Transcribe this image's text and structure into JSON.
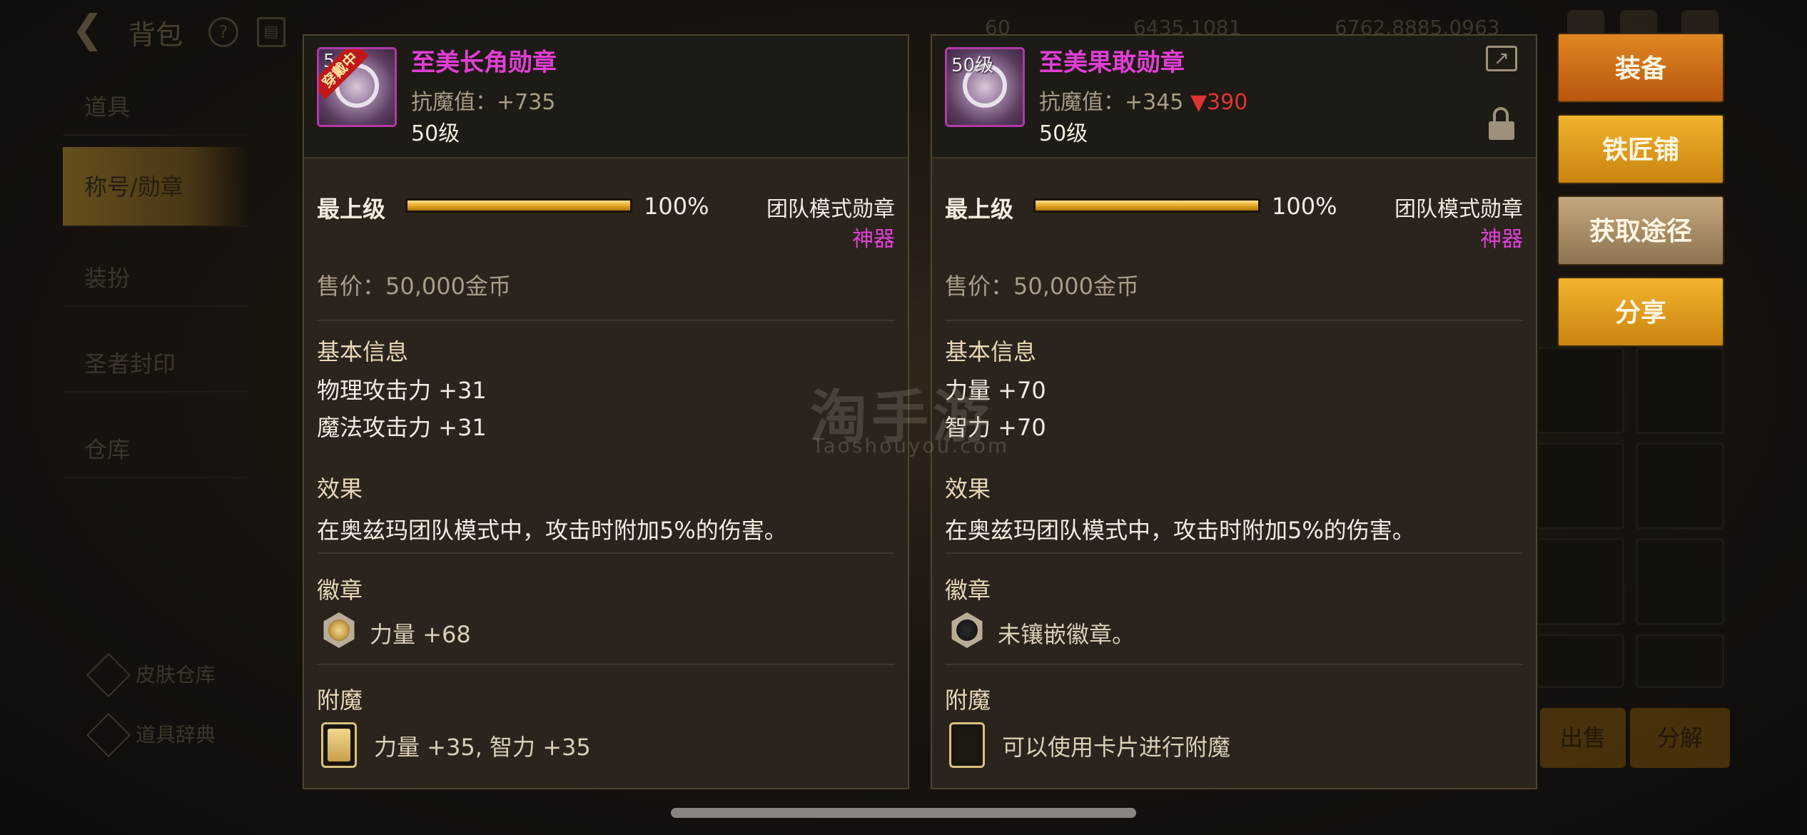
{
  "background": {
    "header": {
      "title": "背包",
      "help_icon": "question-icon",
      "book_icon": "book-icon",
      "resource_1": "60",
      "resource_2": "6435.1081",
      "resource_3": "6762.8885.0963"
    },
    "side_menu": {
      "items": [
        {
          "label": "道具"
        },
        {
          "label": "称号/勋章"
        },
        {
          "label": "装扮"
        },
        {
          "label": "圣者封印"
        },
        {
          "label": "仓库"
        }
      ],
      "footer": [
        {
          "label": "皮肤仓库"
        },
        {
          "label": "道具辞典"
        }
      ]
    },
    "buttons": {
      "sell": "出售",
      "split": "分解"
    }
  },
  "watermark": {
    "main": "淘手游",
    "sub": "Taoshouyou.com"
  },
  "panels": [
    {
      "name": "至美长角勋章",
      "level_badge": "5",
      "wearing_tag": "穿戴中",
      "stat": "抗魔值：+735",
      "stat_diff": "",
      "level": "50级",
      "grade_label": "最上级",
      "grade_percent": "100%",
      "grade_value": 1.0,
      "mode": "团队模式勋章",
      "rarity": "神器",
      "price": "售价：50,000金币",
      "basic_title": "基本信息",
      "basic_lines": [
        "物理攻击力 +31",
        "魔法攻击力 +31"
      ],
      "effect_title": "效果",
      "effect_text": "在奥兹玛团队模式中，攻击时附加5%的伤害。",
      "emblem_title": "徽章",
      "emblem_text": "力量 +68",
      "emblem_filled": true,
      "enchant_title": "附魔",
      "enchant_text": "力量 +35, 智力 +35",
      "enchant_filled": true
    },
    {
      "name": "至美果敢勋章",
      "level_badge": "50级",
      "wearing_tag": "",
      "stat": "抗魔值：+345",
      "stat_diff": "▼390",
      "level": "50级",
      "grade_label": "最上级",
      "grade_percent": "100%",
      "grade_value": 1.0,
      "mode": "团队模式勋章",
      "rarity": "神器",
      "price": "售价：50,000金币",
      "basic_title": "基本信息",
      "basic_lines": [
        "力量 +70",
        "智力 +70"
      ],
      "effect_title": "效果",
      "effect_text": "在奥兹玛团队模式中，攻击时附加5%的伤害。",
      "emblem_title": "徽章",
      "emblem_text": "未镶嵌徽章。",
      "emblem_filled": false,
      "enchant_title": "附魔",
      "enchant_text": "可以使用卡片进行附魔",
      "enchant_filled": false
    }
  ],
  "actions": {
    "equip": "装备",
    "smith": "铁匠铺",
    "source": "获取途径",
    "share": "分享"
  },
  "colors": {
    "item_name": "#e23fd6",
    "rarity": "#e23fd6",
    "stat_down": "#e03434",
    "equip_button": "#d0741a",
    "smith_button": "#e3a120"
  }
}
